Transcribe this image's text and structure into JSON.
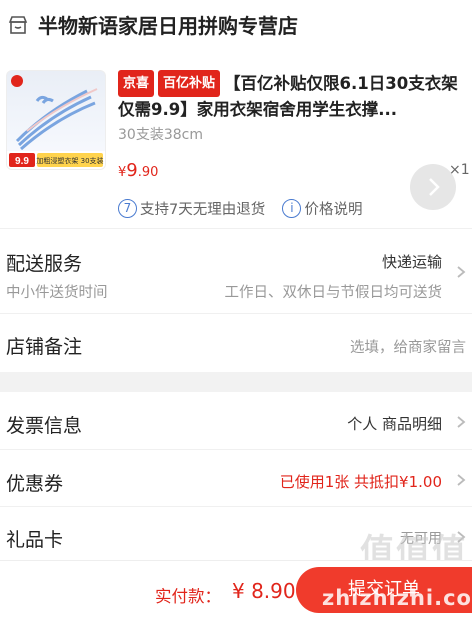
{
  "store": {
    "name": "半物新语家居日用拼购专营店",
    "icon": "store-icon"
  },
  "product": {
    "tags": [
      "京喜",
      "百亿补贴"
    ],
    "title": "【百亿补贴仅限6.1日30支衣架仅需9.9】家用衣架宿舍用学生衣撑...",
    "spec": "30支装38cm",
    "price_symbol": "¥",
    "price_int": "9",
    "price_dec": ".90",
    "quantity": "×1",
    "thumb_badge": "9.9",
    "thumb_text": "加粗浸塑衣架 30支装",
    "service_return": "支持7天无理由退货",
    "service_return_num": "7",
    "price_desc": "价格说明",
    "price_desc_icon": "i"
  },
  "delivery": {
    "label": "配送服务",
    "value": "快递运输",
    "sub_left": "中小件送货时间",
    "sub_right": "工作日、双休日与节假日均可送货"
  },
  "remark": {
    "label": "店铺备注",
    "placeholder": "选填，给商家留言"
  },
  "invoice": {
    "label": "发票信息",
    "value": "个人 商品明细"
  },
  "coupon": {
    "label": "优惠券",
    "value": "已使用1张 共抵扣¥1.00"
  },
  "giftcard": {
    "label": "礼品卡",
    "value": "无可用"
  },
  "footer": {
    "pay_label": "实付款：",
    "pay_amount": "¥ 8.90",
    "submit_label": "提交订单"
  },
  "watermark": {
    "text": "zhizhizhi.com",
    "logo": "值值值"
  },
  "colors": {
    "accent": "#e1251b",
    "submit": "#f03b2c",
    "link": "#4a7bd0"
  }
}
